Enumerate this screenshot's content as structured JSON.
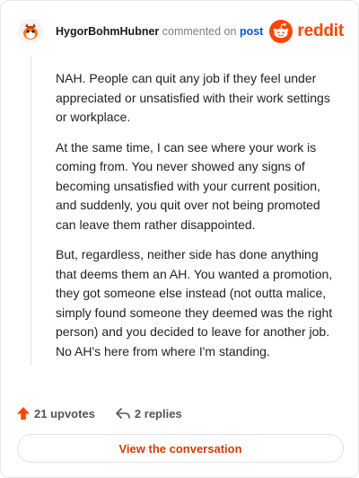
{
  "header": {
    "username": "HygorBohmHubner",
    "action_text": "commented on",
    "post_link": "post",
    "brand": "reddit"
  },
  "comment": {
    "paragraphs": [
      "NAH. People can quit any job if they feel under appreciated or unsatisfied with their work settings or workplace.",
      "At the same time, I can see where your work is coming from. You never showed any signs of becoming unsatisfied with your current position, and suddenly, you quit over not being promoted can leave them rather disappointed.",
      "But, regardless, neither side has done anything that deems them an AH. You wanted a promotion, they got someone else instead (not outta malice, simply found someone they deemed was the right person) and you decided to leave for another job. No AH's here from where I'm standing."
    ]
  },
  "footer": {
    "upvotes": "21 upvotes",
    "replies": "2 replies",
    "upvote_icon": "upvote-arrow-icon",
    "reply_icon": "reply-icon"
  },
  "cta": {
    "label": "View the conversation"
  },
  "colors": {
    "brand": "#ff4500",
    "link": "#0b53ce",
    "cta_text": "#d93900"
  }
}
